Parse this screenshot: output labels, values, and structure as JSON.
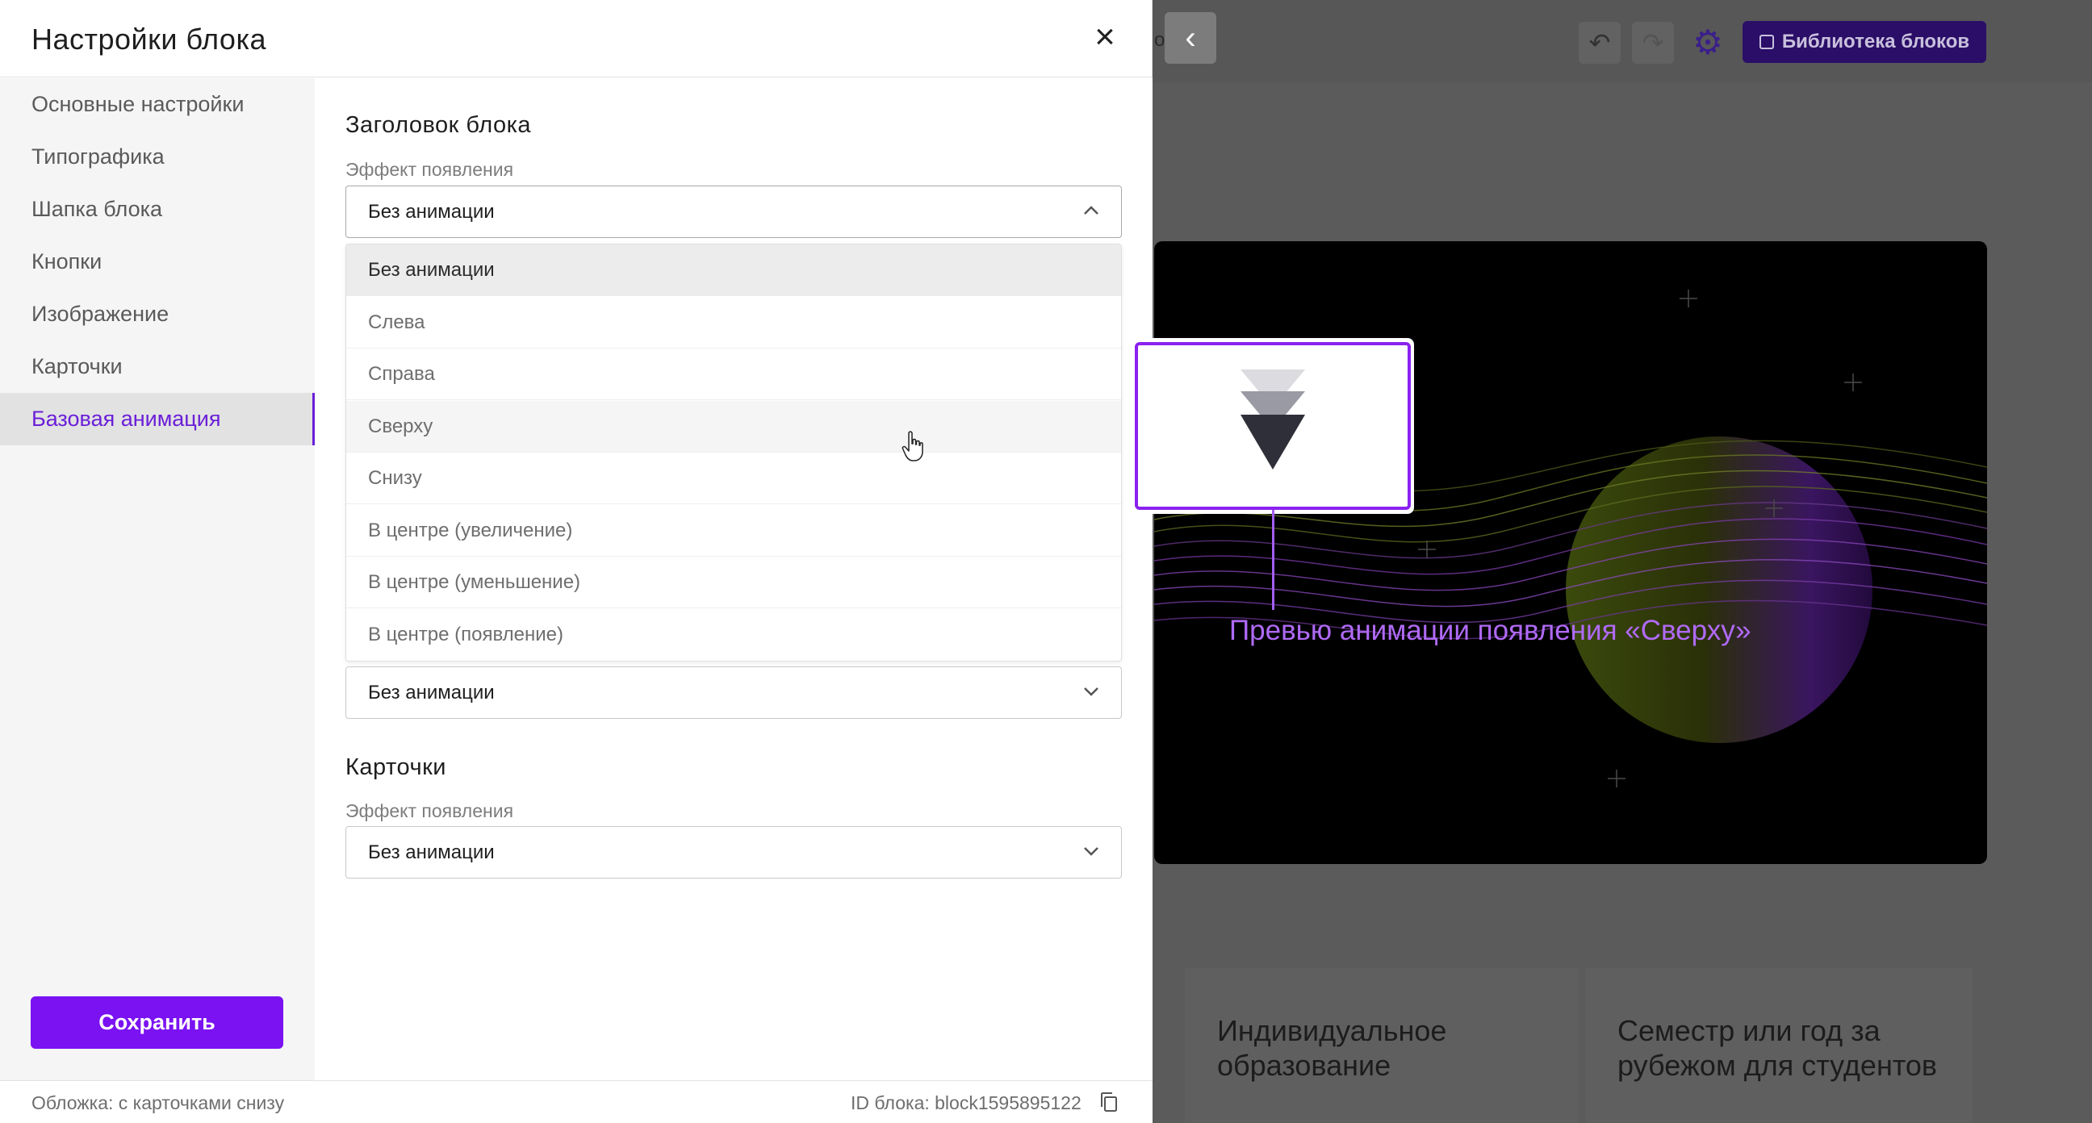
{
  "modal": {
    "title": "Настройки блока",
    "close_icon": "close-icon"
  },
  "sidebar": {
    "items": [
      {
        "label": "Основные настройки",
        "active": false
      },
      {
        "label": "Типографика",
        "active": false
      },
      {
        "label": "Шапка блока",
        "active": false
      },
      {
        "label": "Кнопки",
        "active": false
      },
      {
        "label": "Изображение",
        "active": false
      },
      {
        "label": "Карточки",
        "active": false
      },
      {
        "label": "Базовая анимация",
        "active": true
      }
    ],
    "save_label": "Сохранить"
  },
  "sections": {
    "heading": {
      "title": "Заголовок блока",
      "effect_label": "Эффект появления",
      "value": "Без анимации",
      "expanded": true
    },
    "hidden_select_value": "Без анимации",
    "cards": {
      "title": "Карточки",
      "effect_label": "Эффект появления",
      "value": "Без анимации"
    }
  },
  "dropdown": {
    "options": [
      "Без анимации",
      "Слева",
      "Справа",
      "Сверху",
      "Снизу",
      "В центре (увеличение)",
      "В центре (уменьшение)",
      "В центре (появление)"
    ],
    "selected_index": 0,
    "hovered_index": 3
  },
  "footer": {
    "left": "Обложка: с карточками снизу",
    "right": "ID блока: block1595895122",
    "copy_icon": "copy-icon"
  },
  "preview": {
    "caption": "Превью анимации появления «Сверху»"
  },
  "editor": {
    "preview_peek": "отр",
    "library_label": "Библиотека блоков",
    "cards": [
      "Индивидуальное образование",
      "Семестр или год за рубежом для студентов"
    ]
  },
  "colors": {
    "accent": "#7a12f2",
    "active_text": "#6a1ed8",
    "callout": "#b06af6"
  }
}
